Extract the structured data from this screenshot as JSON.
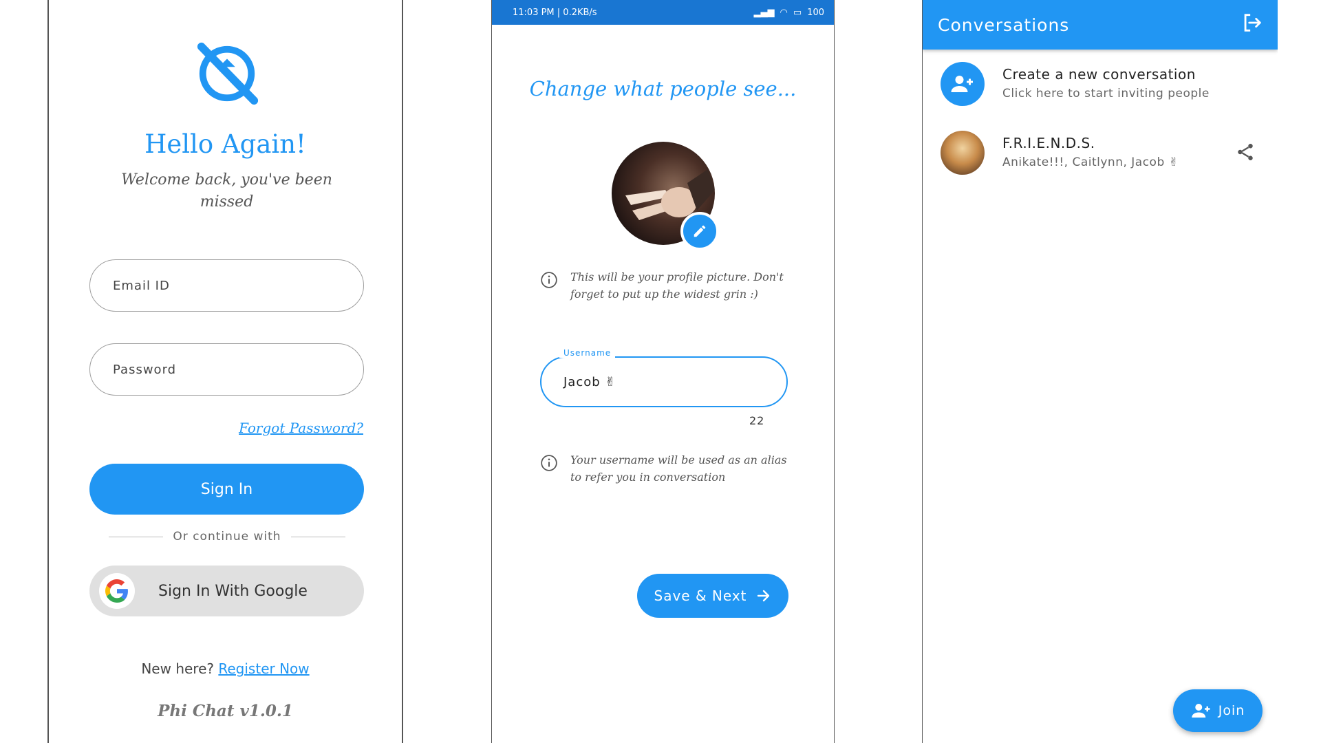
{
  "login": {
    "heading": "Hello Again!",
    "subheading": "Welcome back, you've been missed",
    "email_placeholder": "Email ID",
    "password_placeholder": "Password",
    "forgot_label": "Forgot Password?",
    "signin_label": "Sign In",
    "divider_label": "Or continue with",
    "google_label": "Sign In With Google",
    "new_here": "New here?",
    "register_label": "Register Now",
    "version": "Phi Chat v1.0.1"
  },
  "profile": {
    "status_left": "11:03 PM | 0.2KB/s",
    "status_right": "100",
    "title": "Change what people see...",
    "picture_info": "This will be your profile picture. Don't forget to put up the widest grin :)",
    "username_label": "Username",
    "username_value": "Jacob ✌",
    "counter": "22",
    "username_info": "Your username will be used as an alias to refer you in conversation",
    "save_label": "Save & Next"
  },
  "conversations": {
    "title": "Conversations",
    "create_title": "Create a new conversation",
    "create_subtitle": "Click here to start inviting people",
    "friends_name": "F.R.I.E.N.D.S.",
    "friends_members": "Anikate!!!, Caitlynn, Jacob ✌",
    "join_label": "Join"
  },
  "colors": {
    "accent": "#2196f3",
    "statusbar": "#1976d2"
  }
}
